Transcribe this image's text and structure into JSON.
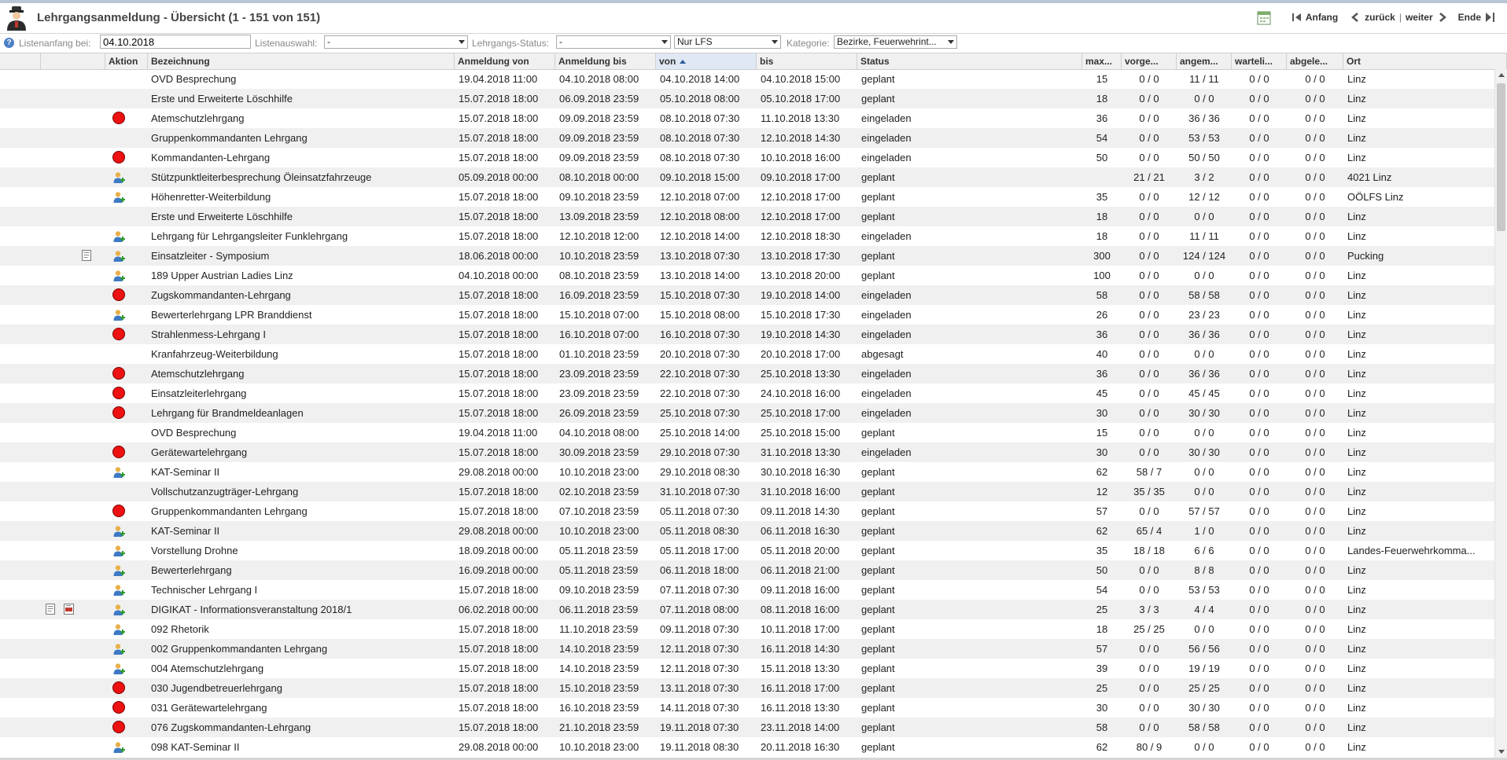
{
  "header": {
    "title": "Lehrgangsanmeldung - Übersicht (1 - 151 von 151)",
    "nav": {
      "first": "Anfang",
      "back": "zurück",
      "separator": "|",
      "next": "weiter",
      "last": "Ende"
    }
  },
  "filter": {
    "start_label": "Listenanfang bei:",
    "start_value": "04.10.2018",
    "list_label": "Listenauswahl:",
    "list_value": "-",
    "status_label": "Lehrgangs-Status:",
    "status_value": "-",
    "lfs_value": "Nur LFS",
    "category_label": "Kategorie:",
    "category_value": "Bezirke, Feuerwehrint..."
  },
  "columns": {
    "aktion": "Aktion",
    "bezeichnung": "Bezeichnung",
    "anm_von": "Anmeldung von",
    "anm_bis": "Anmeldung bis",
    "von": "von",
    "bis": "bis",
    "status": "Status",
    "max": "max...",
    "vorge": "vorge...",
    "angem": "angem...",
    "warte": "warteli...",
    "abgele": "abgele...",
    "ort": "Ort"
  },
  "icon_names": {
    "dot": "red-status-icon",
    "user": "user-add-icon",
    "doc": "document-icon",
    "pdf": "pdf-icon"
  },
  "rows": [
    {
      "icons": [],
      "action": "",
      "name": "OVD Besprechung",
      "anm_von": "19.04.2018 11:00",
      "anm_bis": "04.10.2018 08:00",
      "von": "04.10.2018 14:00",
      "bis": "04.10.2018 15:00",
      "status": "geplant",
      "max": "15",
      "vorge": "0 / 0",
      "angem": "11 / 11",
      "warte": "0 / 0",
      "abgele": "0 / 0",
      "ort": "Linz"
    },
    {
      "icons": [],
      "action": "",
      "name": "Erste und Erweiterte Löschhilfe",
      "anm_von": "15.07.2018 18:00",
      "anm_bis": "06.09.2018 23:59",
      "von": "05.10.2018 08:00",
      "bis": "05.10.2018 17:00",
      "status": "geplant",
      "max": "18",
      "vorge": "0 / 0",
      "angem": "0 / 0",
      "warte": "0 / 0",
      "abgele": "0 / 0",
      "ort": "Linz"
    },
    {
      "icons": [],
      "action": "dot",
      "name": "Atemschutzlehrgang",
      "anm_von": "15.07.2018 18:00",
      "anm_bis": "09.09.2018 23:59",
      "von": "08.10.2018 07:30",
      "bis": "11.10.2018 13:30",
      "status": "eingeladen",
      "max": "36",
      "vorge": "0 / 0",
      "angem": "36 / 36",
      "warte": "0 / 0",
      "abgele": "0 / 0",
      "ort": "Linz"
    },
    {
      "icons": [],
      "action": "",
      "name": "Gruppenkommandanten Lehrgang",
      "anm_von": "15.07.2018 18:00",
      "anm_bis": "09.09.2018 23:59",
      "von": "08.10.2018 07:30",
      "bis": "12.10.2018 14:30",
      "status": "eingeladen",
      "max": "54",
      "vorge": "0 / 0",
      "angem": "53 / 53",
      "warte": "0 / 0",
      "abgele": "0 / 0",
      "ort": "Linz"
    },
    {
      "icons": [],
      "action": "dot",
      "name": "Kommandanten-Lehrgang",
      "anm_von": "15.07.2018 18:00",
      "anm_bis": "09.09.2018 23:59",
      "von": "08.10.2018 07:30",
      "bis": "10.10.2018 16:00",
      "status": "eingeladen",
      "max": "50",
      "vorge": "0 / 0",
      "angem": "50 / 50",
      "warte": "0 / 0",
      "abgele": "0 / 0",
      "ort": "Linz"
    },
    {
      "icons": [],
      "action": "user",
      "name": "Stützpunktleiterbesprechung Öleinsatzfahrzeuge",
      "anm_von": "05.09.2018 00:00",
      "anm_bis": "08.10.2018 00:00",
      "von": "09.10.2018 15:00",
      "bis": "09.10.2018 17:00",
      "status": "geplant",
      "max": "",
      "vorge": "21 / 21",
      "angem": "3 / 2",
      "warte": "0 / 0",
      "abgele": "0 / 0",
      "ort": "4021 Linz"
    },
    {
      "icons": [],
      "action": "user",
      "name": "Höhenretter-Weiterbildung",
      "anm_von": "15.07.2018 18:00",
      "anm_bis": "09.10.2018 23:59",
      "von": "12.10.2018 07:00",
      "bis": "12.10.2018 17:00",
      "status": "geplant",
      "max": "35",
      "vorge": "0 / 0",
      "angem": "12 / 12",
      "warte": "0 / 0",
      "abgele": "0 / 0",
      "ort": "OÖLFS Linz"
    },
    {
      "icons": [],
      "action": "",
      "name": "Erste und Erweiterte Löschhilfe",
      "anm_von": "15.07.2018 18:00",
      "anm_bis": "13.09.2018 23:59",
      "von": "12.10.2018 08:00",
      "bis": "12.10.2018 17:00",
      "status": "geplant",
      "max": "18",
      "vorge": "0 / 0",
      "angem": "0 / 0",
      "warte": "0 / 0",
      "abgele": "0 / 0",
      "ort": "Linz"
    },
    {
      "icons": [],
      "action": "user",
      "name": "Lehrgang für Lehrgangsleiter Funklehrgang",
      "anm_von": "15.07.2018 18:00",
      "anm_bis": "12.10.2018 12:00",
      "von": "12.10.2018 14:00",
      "bis": "12.10.2018 18:30",
      "status": "eingeladen",
      "max": "18",
      "vorge": "0 / 0",
      "angem": "11 / 11",
      "warte": "0 / 0",
      "abgele": "0 / 0",
      "ort": "Linz"
    },
    {
      "icons": [
        "doc"
      ],
      "action": "user",
      "name": "Einsatzleiter - Symposium",
      "anm_von": "18.06.2018 00:00",
      "anm_bis": "10.10.2018 23:59",
      "von": "13.10.2018 07:30",
      "bis": "13.10.2018 17:30",
      "status": "geplant",
      "max": "300",
      "vorge": "0 / 0",
      "angem": "124 / 124",
      "warte": "0 / 0",
      "abgele": "0 / 0",
      "ort": "Pucking"
    },
    {
      "icons": [],
      "action": "user",
      "name": "189 Upper Austrian Ladies Linz",
      "anm_von": "04.10.2018 00:00",
      "anm_bis": "08.10.2018 23:59",
      "von": "13.10.2018 14:00",
      "bis": "13.10.2018 20:00",
      "status": "geplant",
      "max": "100",
      "vorge": "0 / 0",
      "angem": "0 / 0",
      "warte": "0 / 0",
      "abgele": "0 / 0",
      "ort": "Linz"
    },
    {
      "icons": [],
      "action": "dot",
      "name": "Zugskommandanten-Lehrgang",
      "anm_von": "15.07.2018 18:00",
      "anm_bis": "16.09.2018 23:59",
      "von": "15.10.2018 07:30",
      "bis": "19.10.2018 14:00",
      "status": "eingeladen",
      "max": "58",
      "vorge": "0 / 0",
      "angem": "58 / 58",
      "warte": "0 / 0",
      "abgele": "0 / 0",
      "ort": "Linz"
    },
    {
      "icons": [],
      "action": "user",
      "name": "Bewerterlehrgang LPR Branddienst",
      "anm_von": "15.07.2018 18:00",
      "anm_bis": "15.10.2018 07:00",
      "von": "15.10.2018 08:00",
      "bis": "15.10.2018 17:30",
      "status": "eingeladen",
      "max": "26",
      "vorge": "0 / 0",
      "angem": "23 / 23",
      "warte": "0 / 0",
      "abgele": "0 / 0",
      "ort": "Linz"
    },
    {
      "icons": [],
      "action": "dot",
      "name": "Strahlenmess-Lehrgang I",
      "anm_von": "15.07.2018 18:00",
      "anm_bis": "16.10.2018 07:00",
      "von": "16.10.2018 07:30",
      "bis": "19.10.2018 14:30",
      "status": "eingeladen",
      "max": "36",
      "vorge": "0 / 0",
      "angem": "36 / 36",
      "warte": "0 / 0",
      "abgele": "0 / 0",
      "ort": "Linz"
    },
    {
      "icons": [],
      "action": "",
      "name": "Kranfahrzeug-Weiterbildung",
      "anm_von": "15.07.2018 18:00",
      "anm_bis": "01.10.2018 23:59",
      "von": "20.10.2018 07:30",
      "bis": "20.10.2018 17:00",
      "status": "abgesagt",
      "max": "40",
      "vorge": "0 / 0",
      "angem": "0 / 0",
      "warte": "0 / 0",
      "abgele": "0 / 0",
      "ort": "Linz"
    },
    {
      "icons": [],
      "action": "dot",
      "name": "Atemschutzlehrgang",
      "anm_von": "15.07.2018 18:00",
      "anm_bis": "23.09.2018 23:59",
      "von": "22.10.2018 07:30",
      "bis": "25.10.2018 13:30",
      "status": "eingeladen",
      "max": "36",
      "vorge": "0 / 0",
      "angem": "36 / 36",
      "warte": "0 / 0",
      "abgele": "0 / 0",
      "ort": "Linz"
    },
    {
      "icons": [],
      "action": "dot",
      "name": "Einsatzleiterlehrgang",
      "anm_von": "15.07.2018 18:00",
      "anm_bis": "23.09.2018 23:59",
      "von": "22.10.2018 07:30",
      "bis": "24.10.2018 16:00",
      "status": "eingeladen",
      "max": "45",
      "vorge": "0 / 0",
      "angem": "45 / 45",
      "warte": "0 / 0",
      "abgele": "0 / 0",
      "ort": "Linz"
    },
    {
      "icons": [],
      "action": "dot",
      "name": "Lehrgang für Brandmeldeanlagen",
      "anm_von": "15.07.2018 18:00",
      "anm_bis": "26.09.2018 23:59",
      "von": "25.10.2018 07:30",
      "bis": "25.10.2018 17:00",
      "status": "eingeladen",
      "max": "30",
      "vorge": "0 / 0",
      "angem": "30 / 30",
      "warte": "0 / 0",
      "abgele": "0 / 0",
      "ort": "Linz"
    },
    {
      "icons": [],
      "action": "",
      "name": "OVD Besprechung",
      "anm_von": "19.04.2018 11:00",
      "anm_bis": "04.10.2018 08:00",
      "von": "25.10.2018 14:00",
      "bis": "25.10.2018 15:00",
      "status": "geplant",
      "max": "15",
      "vorge": "0 / 0",
      "angem": "0 / 0",
      "warte": "0 / 0",
      "abgele": "0 / 0",
      "ort": "Linz"
    },
    {
      "icons": [],
      "action": "dot",
      "name": "Gerätewartelehrgang",
      "anm_von": "15.07.2018 18:00",
      "anm_bis": "30.09.2018 23:59",
      "von": "29.10.2018 07:30",
      "bis": "31.10.2018 13:30",
      "status": "eingeladen",
      "max": "30",
      "vorge": "0 / 0",
      "angem": "30 / 30",
      "warte": "0 / 0",
      "abgele": "0 / 0",
      "ort": "Linz"
    },
    {
      "icons": [],
      "action": "user",
      "name": "KAT-Seminar II",
      "anm_von": "29.08.2018 00:00",
      "anm_bis": "10.10.2018 23:00",
      "von": "29.10.2018 08:30",
      "bis": "30.10.2018 16:30",
      "status": "geplant",
      "max": "62",
      "vorge": "58 / 7",
      "angem": "0 / 0",
      "warte": "0 / 0",
      "abgele": "0 / 0",
      "ort": "Linz"
    },
    {
      "icons": [],
      "action": "",
      "name": "Vollschutzanzugträger-Lehrgang",
      "anm_von": "15.07.2018 18:00",
      "anm_bis": "02.10.2018 23:59",
      "von": "31.10.2018 07:30",
      "bis": "31.10.2018 16:00",
      "status": "geplant",
      "max": "12",
      "vorge": "35 / 35",
      "angem": "0 / 0",
      "warte": "0 / 0",
      "abgele": "0 / 0",
      "ort": "Linz"
    },
    {
      "icons": [],
      "action": "dot",
      "name": "Gruppenkommandanten Lehrgang",
      "anm_von": "15.07.2018 18:00",
      "anm_bis": "07.10.2018 23:59",
      "von": "05.11.2018 07:30",
      "bis": "09.11.2018 14:30",
      "status": "geplant",
      "max": "57",
      "vorge": "0 / 0",
      "angem": "57 / 57",
      "warte": "0 / 0",
      "abgele": "0 / 0",
      "ort": "Linz"
    },
    {
      "icons": [],
      "action": "user",
      "name": "KAT-Seminar II",
      "anm_von": "29.08.2018 00:00",
      "anm_bis": "10.10.2018 23:00",
      "von": "05.11.2018 08:30",
      "bis": "06.11.2018 16:30",
      "status": "geplant",
      "max": "62",
      "vorge": "65 / 4",
      "angem": "1 / 0",
      "warte": "0 / 0",
      "abgele": "0 / 0",
      "ort": "Linz"
    },
    {
      "icons": [],
      "action": "user",
      "name": "Vorstellung Drohne",
      "anm_von": "18.09.2018 00:00",
      "anm_bis": "05.11.2018 23:59",
      "von": "05.11.2018 17:00",
      "bis": "05.11.2018 20:00",
      "status": "geplant",
      "max": "35",
      "vorge": "18 / 18",
      "angem": "6 / 6",
      "warte": "0 / 0",
      "abgele": "0 / 0",
      "ort": "Landes-Feuerwehrkomma..."
    },
    {
      "icons": [],
      "action": "user",
      "name": "Bewerterlehrgang",
      "anm_von": "16.09.2018 00:00",
      "anm_bis": "05.11.2018 23:59",
      "von": "06.11.2018 18:00",
      "bis": "06.11.2018 21:00",
      "status": "geplant",
      "max": "50",
      "vorge": "0 / 0",
      "angem": "8 / 8",
      "warte": "0 / 0",
      "abgele": "0 / 0",
      "ort": "Linz"
    },
    {
      "icons": [],
      "action": "user",
      "name": "Technischer Lehrgang I",
      "anm_von": "15.07.2018 18:00",
      "anm_bis": "09.10.2018 23:59",
      "von": "07.11.2018 07:30",
      "bis": "09.11.2018 16:00",
      "status": "geplant",
      "max": "54",
      "vorge": "0 / 0",
      "angem": "53 / 53",
      "warte": "0 / 0",
      "abgele": "0 / 0",
      "ort": "Linz"
    },
    {
      "icons": [
        "doc",
        "pdf"
      ],
      "action": "user",
      "name": "DIGIKAT - Informationsveranstaltung 2018/1",
      "anm_von": "06.02.2018 00:00",
      "anm_bis": "06.11.2018 23:59",
      "von": "07.11.2018 08:00",
      "bis": "08.11.2018 16:00",
      "status": "geplant",
      "max": "25",
      "vorge": "3 / 3",
      "angem": "4 / 4",
      "warte": "0 / 0",
      "abgele": "0 / 0",
      "ort": "Linz"
    },
    {
      "icons": [],
      "action": "user",
      "name": "092 Rhetorik",
      "anm_von": "15.07.2018 18:00",
      "anm_bis": "11.10.2018 23:59",
      "von": "09.11.2018 07:30",
      "bis": "10.11.2018 17:00",
      "status": "geplant",
      "max": "18",
      "vorge": "25 / 25",
      "angem": "0 / 0",
      "warte": "0 / 0",
      "abgele": "0 / 0",
      "ort": "Linz"
    },
    {
      "icons": [],
      "action": "user",
      "name": "002 Gruppenkommandanten Lehrgang",
      "anm_von": "15.07.2018 18:00",
      "anm_bis": "14.10.2018 23:59",
      "von": "12.11.2018 07:30",
      "bis": "16.11.2018 14:30",
      "status": "geplant",
      "max": "57",
      "vorge": "0 / 0",
      "angem": "56 / 56",
      "warte": "0 / 0",
      "abgele": "0 / 0",
      "ort": "Linz"
    },
    {
      "icons": [],
      "action": "user",
      "name": "004 Atemschutzlehrgang",
      "anm_von": "15.07.2018 18:00",
      "anm_bis": "14.10.2018 23:59",
      "von": "12.11.2018 07:30",
      "bis": "15.11.2018 13:30",
      "status": "geplant",
      "max": "39",
      "vorge": "0 / 0",
      "angem": "19 / 19",
      "warte": "0 / 0",
      "abgele": "0 / 0",
      "ort": "Linz"
    },
    {
      "icons": [],
      "action": "dot",
      "name": "030 Jugendbetreuerlehrgang",
      "anm_von": "15.07.2018 18:00",
      "anm_bis": "15.10.2018 23:59",
      "von": "13.11.2018 07:30",
      "bis": "16.11.2018 17:00",
      "status": "geplant",
      "max": "25",
      "vorge": "0 / 0",
      "angem": "25 / 25",
      "warte": "0 / 0",
      "abgele": "0 / 0",
      "ort": "Linz"
    },
    {
      "icons": [],
      "action": "dot",
      "name": "031 Gerätewartelehrgang",
      "anm_von": "15.07.2018 18:00",
      "anm_bis": "16.10.2018 23:59",
      "von": "14.11.2018 07:30",
      "bis": "16.11.2018 13:30",
      "status": "geplant",
      "max": "30",
      "vorge": "0 / 0",
      "angem": "30 / 30",
      "warte": "0 / 0",
      "abgele": "0 / 0",
      "ort": "Linz"
    },
    {
      "icons": [],
      "action": "dot",
      "name": "076 Zugskommandanten-Lehrgang",
      "anm_von": "15.07.2018 18:00",
      "anm_bis": "21.10.2018 23:59",
      "von": "19.11.2018 07:30",
      "bis": "23.11.2018 14:00",
      "status": "geplant",
      "max": "58",
      "vorge": "0 / 0",
      "angem": "58 / 58",
      "warte": "0 / 0",
      "abgele": "0 / 0",
      "ort": "Linz"
    },
    {
      "icons": [],
      "action": "user",
      "name": "098 KAT-Seminar II",
      "anm_von": "29.08.2018 00:00",
      "anm_bis": "10.10.2018 23:00",
      "von": "19.11.2018 08:30",
      "bis": "20.11.2018 16:30",
      "status": "geplant",
      "max": "62",
      "vorge": "80 / 9",
      "angem": "0 / 0",
      "warte": "0 / 0",
      "abgele": "0 / 0",
      "ort": "Linz"
    }
  ]
}
